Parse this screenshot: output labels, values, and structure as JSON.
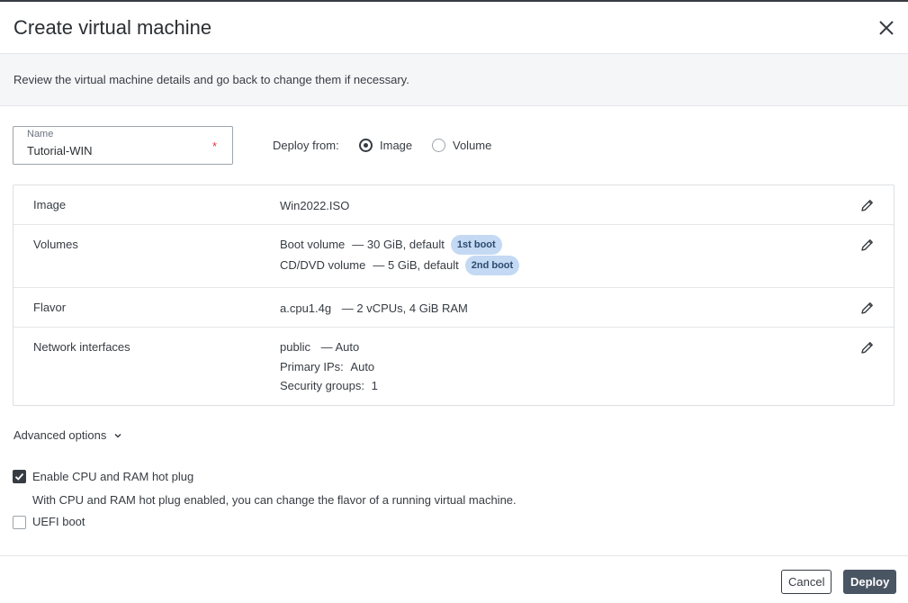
{
  "dialog": {
    "title": "Create virtual machine",
    "intro": "Review the virtual machine details and go back to change them if necessary."
  },
  "name_field": {
    "label": "Name",
    "value": "Tutorial-WIN",
    "required_mark": "*"
  },
  "deploy_from": {
    "label": "Deploy from:",
    "options": [
      "Image",
      "Volume"
    ],
    "selected": "Image"
  },
  "summary": {
    "image": {
      "label": "Image",
      "value": "Win2022.ISO"
    },
    "volumes": {
      "label": "Volumes",
      "items": [
        {
          "name": "Boot volume",
          "detail": "— 30 GiB, default",
          "badge": "1st boot"
        },
        {
          "name": "CD/DVD volume",
          "detail": "— 5 GiB, default",
          "badge": "2nd boot"
        }
      ]
    },
    "flavor": {
      "label": "Flavor",
      "name": "a.cpu1.4g",
      "detail": "— 2 vCPUs, 4 GiB RAM"
    },
    "network": {
      "label": "Network interfaces",
      "name": "public",
      "detail": "— Auto",
      "primary_ips_label": "Primary IPs:",
      "primary_ips_value": "Auto",
      "security_groups_label": "Security groups:",
      "security_groups_value": "1"
    }
  },
  "advanced": {
    "label": "Advanced options",
    "hotplug": {
      "label": "Enable CPU and RAM hot plug",
      "checked": true,
      "hint": "With CPU and RAM hot plug enabled, you can change the flavor of a running virtual machine."
    },
    "uefi": {
      "label": "UEFI boot",
      "checked": false
    }
  },
  "footer": {
    "cancel_label": "Cancel",
    "deploy_label": "Deploy"
  },
  "colors": {
    "badge_bg": "#c4d9f3",
    "primary_button": "#4a5563",
    "required": "#e0393e"
  },
  "icons": [
    "close-icon",
    "pencil-icon",
    "chevron-down-icon",
    "checkmark-icon"
  ]
}
